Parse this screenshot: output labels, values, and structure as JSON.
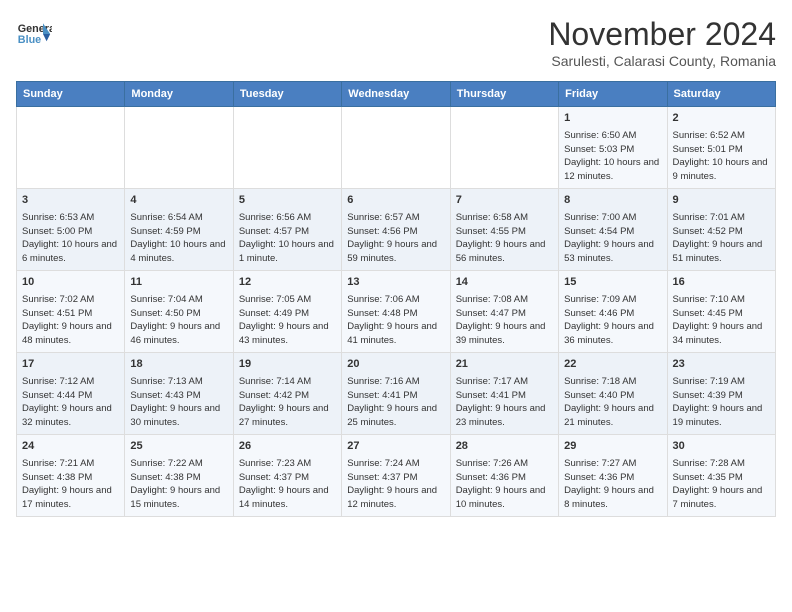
{
  "header": {
    "logo_line1": "General",
    "logo_line2": "Blue",
    "month_title": "November 2024",
    "subtitle": "Sarulesti, Calarasi County, Romania"
  },
  "days_of_week": [
    "Sunday",
    "Monday",
    "Tuesday",
    "Wednesday",
    "Thursday",
    "Friday",
    "Saturday"
  ],
  "weeks": [
    [
      {
        "day": "",
        "content": ""
      },
      {
        "day": "",
        "content": ""
      },
      {
        "day": "",
        "content": ""
      },
      {
        "day": "",
        "content": ""
      },
      {
        "day": "",
        "content": ""
      },
      {
        "day": "1",
        "content": "Sunrise: 6:50 AM\nSunset: 5:03 PM\nDaylight: 10 hours and 12 minutes."
      },
      {
        "day": "2",
        "content": "Sunrise: 6:52 AM\nSunset: 5:01 PM\nDaylight: 10 hours and 9 minutes."
      }
    ],
    [
      {
        "day": "3",
        "content": "Sunrise: 6:53 AM\nSunset: 5:00 PM\nDaylight: 10 hours and 6 minutes."
      },
      {
        "day": "4",
        "content": "Sunrise: 6:54 AM\nSunset: 4:59 PM\nDaylight: 10 hours and 4 minutes."
      },
      {
        "day": "5",
        "content": "Sunrise: 6:56 AM\nSunset: 4:57 PM\nDaylight: 10 hours and 1 minute."
      },
      {
        "day": "6",
        "content": "Sunrise: 6:57 AM\nSunset: 4:56 PM\nDaylight: 9 hours and 59 minutes."
      },
      {
        "day": "7",
        "content": "Sunrise: 6:58 AM\nSunset: 4:55 PM\nDaylight: 9 hours and 56 minutes."
      },
      {
        "day": "8",
        "content": "Sunrise: 7:00 AM\nSunset: 4:54 PM\nDaylight: 9 hours and 53 minutes."
      },
      {
        "day": "9",
        "content": "Sunrise: 7:01 AM\nSunset: 4:52 PM\nDaylight: 9 hours and 51 minutes."
      }
    ],
    [
      {
        "day": "10",
        "content": "Sunrise: 7:02 AM\nSunset: 4:51 PM\nDaylight: 9 hours and 48 minutes."
      },
      {
        "day": "11",
        "content": "Sunrise: 7:04 AM\nSunset: 4:50 PM\nDaylight: 9 hours and 46 minutes."
      },
      {
        "day": "12",
        "content": "Sunrise: 7:05 AM\nSunset: 4:49 PM\nDaylight: 9 hours and 43 minutes."
      },
      {
        "day": "13",
        "content": "Sunrise: 7:06 AM\nSunset: 4:48 PM\nDaylight: 9 hours and 41 minutes."
      },
      {
        "day": "14",
        "content": "Sunrise: 7:08 AM\nSunset: 4:47 PM\nDaylight: 9 hours and 39 minutes."
      },
      {
        "day": "15",
        "content": "Sunrise: 7:09 AM\nSunset: 4:46 PM\nDaylight: 9 hours and 36 minutes."
      },
      {
        "day": "16",
        "content": "Sunrise: 7:10 AM\nSunset: 4:45 PM\nDaylight: 9 hours and 34 minutes."
      }
    ],
    [
      {
        "day": "17",
        "content": "Sunrise: 7:12 AM\nSunset: 4:44 PM\nDaylight: 9 hours and 32 minutes."
      },
      {
        "day": "18",
        "content": "Sunrise: 7:13 AM\nSunset: 4:43 PM\nDaylight: 9 hours and 30 minutes."
      },
      {
        "day": "19",
        "content": "Sunrise: 7:14 AM\nSunset: 4:42 PM\nDaylight: 9 hours and 27 minutes."
      },
      {
        "day": "20",
        "content": "Sunrise: 7:16 AM\nSunset: 4:41 PM\nDaylight: 9 hours and 25 minutes."
      },
      {
        "day": "21",
        "content": "Sunrise: 7:17 AM\nSunset: 4:41 PM\nDaylight: 9 hours and 23 minutes."
      },
      {
        "day": "22",
        "content": "Sunrise: 7:18 AM\nSunset: 4:40 PM\nDaylight: 9 hours and 21 minutes."
      },
      {
        "day": "23",
        "content": "Sunrise: 7:19 AM\nSunset: 4:39 PM\nDaylight: 9 hours and 19 minutes."
      }
    ],
    [
      {
        "day": "24",
        "content": "Sunrise: 7:21 AM\nSunset: 4:38 PM\nDaylight: 9 hours and 17 minutes."
      },
      {
        "day": "25",
        "content": "Sunrise: 7:22 AM\nSunset: 4:38 PM\nDaylight: 9 hours and 15 minutes."
      },
      {
        "day": "26",
        "content": "Sunrise: 7:23 AM\nSunset: 4:37 PM\nDaylight: 9 hours and 14 minutes."
      },
      {
        "day": "27",
        "content": "Sunrise: 7:24 AM\nSunset: 4:37 PM\nDaylight: 9 hours and 12 minutes."
      },
      {
        "day": "28",
        "content": "Sunrise: 7:26 AM\nSunset: 4:36 PM\nDaylight: 9 hours and 10 minutes."
      },
      {
        "day": "29",
        "content": "Sunrise: 7:27 AM\nSunset: 4:36 PM\nDaylight: 9 hours and 8 minutes."
      },
      {
        "day": "30",
        "content": "Sunrise: 7:28 AM\nSunset: 4:35 PM\nDaylight: 9 hours and 7 minutes."
      }
    ]
  ]
}
